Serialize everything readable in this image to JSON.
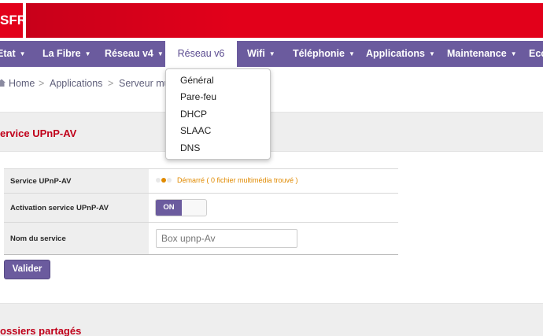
{
  "brand": {
    "logo_text": "SFR",
    "accent": "#e2001a",
    "nav_color": "#6b5b9e"
  },
  "nav": {
    "items": [
      {
        "label": "Etat",
        "caret": "▼"
      },
      {
        "label": "La Fibre",
        "caret": "▼"
      },
      {
        "label": "Réseau v4",
        "caret": "▼"
      },
      {
        "label": "Réseau v6",
        "caret": ""
      },
      {
        "label": "Wifi",
        "caret": "▼"
      },
      {
        "label": "Téléphonie",
        "caret": "▼"
      },
      {
        "label": "Applications",
        "caret": "▼"
      },
      {
        "label": "Maintenance",
        "caret": "▼"
      },
      {
        "label": "Eco"
      }
    ]
  },
  "dropdown": {
    "options": [
      "Général",
      "Pare-feu",
      "DHCP",
      "SLAAC",
      "DNS"
    ]
  },
  "breadcrumb": {
    "home": "Home",
    "sep": ">",
    "level1": "Applications",
    "level2": "Serveur mu"
  },
  "section1": {
    "title": "ervice UPnP-AV"
  },
  "form": {
    "rows": [
      {
        "label": "Service UPnP-AV",
        "status": "Démarré ( 0 fichier multimédia trouvé )"
      },
      {
        "label": "Activation service UPnP-AV",
        "toggle": "ON"
      },
      {
        "label": "Nom du service",
        "placeholder": "Box upnp-Av"
      }
    ],
    "submit": "Valider"
  },
  "section2": {
    "title": "ossiers partagés"
  },
  "icons": {
    "home": "home-icon",
    "status": "status-dots-icon"
  }
}
